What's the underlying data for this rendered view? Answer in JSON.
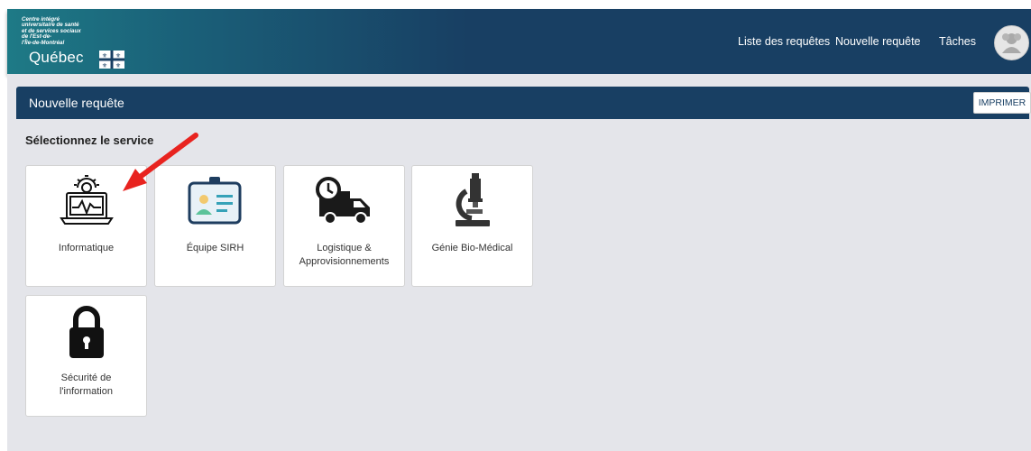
{
  "header": {
    "brand_lines": "Centre intégré\nuniversitaire de santé\net de services sociaux\nde l'Est-de-\nl'Île-de-Montréal",
    "brand_name": "Québec",
    "nav": [
      "Liste des requêtes",
      "Nouvelle requête",
      "Tâches"
    ]
  },
  "panel": {
    "title": "Nouvelle requête",
    "print_label": "IMPRIMER",
    "section_title": "Sélectionnez le service"
  },
  "services": [
    {
      "label": "Informatique",
      "icon": "computer-icon"
    },
    {
      "label": "Équipe SIRH",
      "icon": "id-badge-icon"
    },
    {
      "label": "Logistique &\nApprovisionnements",
      "icon": "delivery-truck-icon"
    },
    {
      "label": "Génie Bio-Médical",
      "icon": "microscope-icon"
    },
    {
      "label": "Sécurité de\nl'information",
      "icon": "lock-icon"
    }
  ],
  "colors": {
    "header_bg": "#183f63",
    "content_bg": "#e4e5ea",
    "annotation_arrow": "#e8231f"
  }
}
